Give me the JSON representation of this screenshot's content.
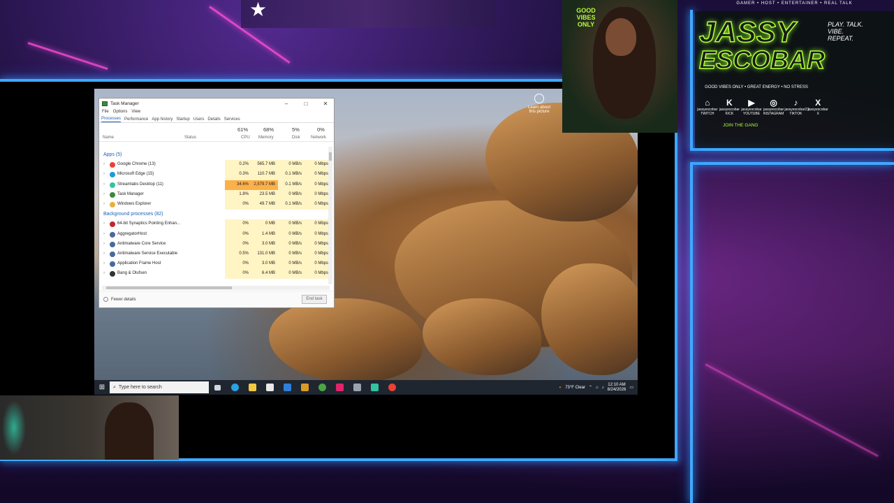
{
  "task_manager": {
    "title": "Task Manager",
    "menu": [
      "File",
      "Options",
      "View"
    ],
    "tabs": [
      "Processes",
      "Performance",
      "App history",
      "Startup",
      "Users",
      "Details",
      "Services"
    ],
    "columns": {
      "name": "Name",
      "status": "Status",
      "cpu": {
        "label": "CPU",
        "pct": "61%"
      },
      "memory": {
        "label": "Memory",
        "pct": "68%"
      },
      "disk": {
        "label": "Disk",
        "pct": "5%"
      },
      "network": {
        "label": "Network",
        "pct": "0%"
      }
    },
    "apps_header": "Apps (5)",
    "apps": [
      {
        "name": "Google Chrome (13)",
        "cpu": "0.2%",
        "mem": "565.7 MB",
        "disk": "0 MB/s",
        "net": "0 Mbps",
        "color": "#e94235"
      },
      {
        "name": "Microsoft Edge (15)",
        "cpu": "0.3%",
        "mem": "110.7 MB",
        "disk": "0.1 MB/s",
        "net": "0 Mbps",
        "color": "#1f9ad6"
      },
      {
        "name": "Streamlabs Desktop (11)",
        "cpu": "34.6%",
        "mem": "2,579.7 MB",
        "disk": "0.1 MB/s",
        "net": "0 Mbps",
        "color": "#31c3a2"
      },
      {
        "name": "Task Manager",
        "cpu": "1.8%",
        "mem": "23.5 MB",
        "disk": "0 MB/s",
        "net": "0 Mbps",
        "color": "#3c8a3c"
      },
      {
        "name": "Windows Explorer",
        "cpu": "0%",
        "mem": "49.7 MB",
        "disk": "0.1 MB/s",
        "net": "0 Mbps",
        "color": "#e8b23a"
      }
    ],
    "bg_header": "Background processes (82)",
    "background": [
      {
        "name": "64-bit Synaptics Pointing Enhan...",
        "cpu": "0%",
        "mem": "0 MB",
        "disk": "0 MB/s",
        "net": "0 Mbps",
        "color": "#c4262e"
      },
      {
        "name": "AggregatorHost",
        "cpu": "0%",
        "mem": "1.4 MB",
        "disk": "0 MB/s",
        "net": "0 Mbps",
        "color": "#4a6a9a"
      },
      {
        "name": "Antimalware Core Service",
        "cpu": "0%",
        "mem": "3.0 MB",
        "disk": "0 MB/s",
        "net": "0 Mbps",
        "color": "#4a6a9a"
      },
      {
        "name": "Antimalware Service Executable",
        "cpu": "0.5%",
        "mem": "131.0 MB",
        "disk": "0 MB/s",
        "net": "0 Mbps",
        "color": "#4a6a9a"
      },
      {
        "name": "Application Frame Host",
        "cpu": "0%",
        "mem": "3.0 MB",
        "disk": "0 MB/s",
        "net": "0 Mbps",
        "color": "#4a6a9a"
      },
      {
        "name": "Bang & Olufsen",
        "cpu": "0%",
        "mem": "6.4 MB",
        "disk": "0 MB/s",
        "net": "0 Mbps",
        "color": "#333333"
      }
    ],
    "fewer_details": "Fewer details",
    "end_task": "End task"
  },
  "desktop": {
    "learn_more": "Learn about this picture"
  },
  "taskbar": {
    "search_placeholder": "Type here to search",
    "weather": "73°F Clear",
    "time": "12:10 AM",
    "date": "8/24/2026"
  },
  "brand": {
    "tagline": "GAMER • HOST • ENTERTAINER • REAL TALK",
    "name_line1": "JASSY",
    "name_line2": "ESCOBAR",
    "play_text": "PLAY. TALK. VIBE. REPEAT.",
    "motto": "GOOD VIBES ONLY • GREAT ENERGY • NO STRESS",
    "good_vibes": "GOOD VIBES ONLY",
    "join": "JOIN THE GANG",
    "socials": [
      {
        "glyph": "⌂",
        "handle": "jassyescobar",
        "platform": "TWITCH"
      },
      {
        "glyph": "K",
        "handle": "jassyescobar",
        "platform": "KICK"
      },
      {
        "glyph": "▶",
        "handle": "jassyescobar",
        "platform": "YOUTUBE"
      },
      {
        "glyph": "◎",
        "handle": "jassyescobar",
        "platform": "INSTAGRAM"
      },
      {
        "glyph": "♪",
        "handle": "jassyescobar23",
        "platform": "TIKTOK"
      },
      {
        "glyph": "X",
        "handle": "jassyescobar",
        "platform": "X"
      }
    ]
  }
}
